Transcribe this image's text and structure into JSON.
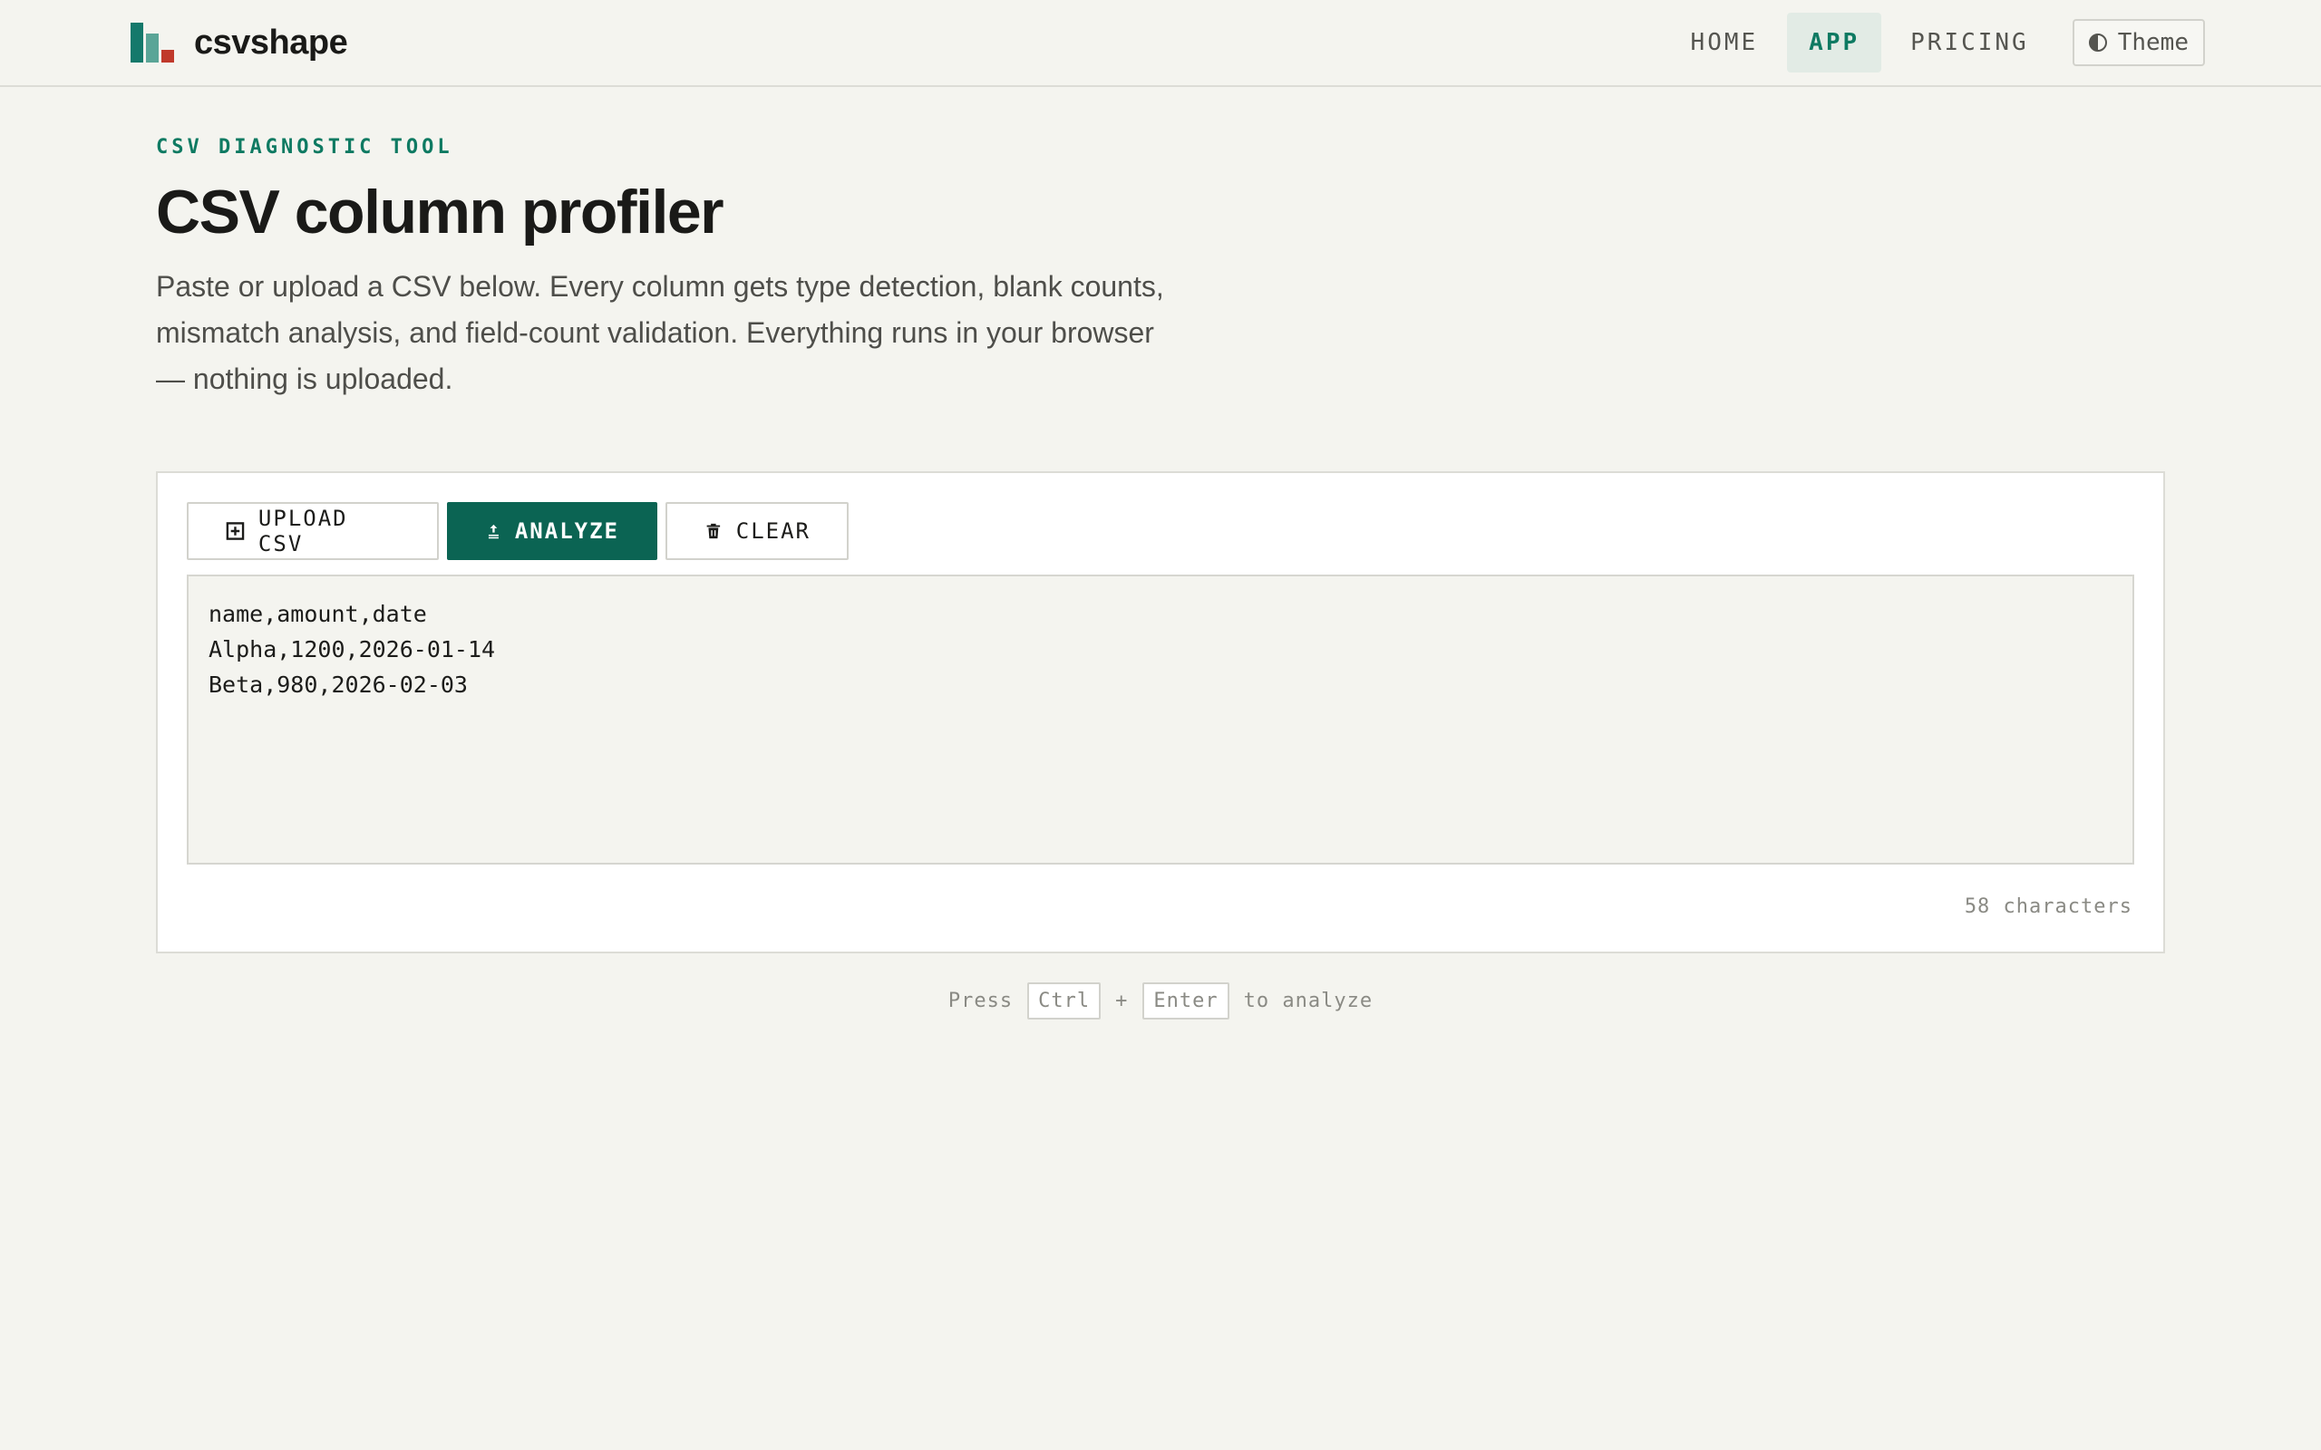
{
  "header": {
    "brand": "csvshape",
    "nav": [
      {
        "label": "HOME",
        "active": false
      },
      {
        "label": "APP",
        "active": true
      },
      {
        "label": "PRICING",
        "active": false
      }
    ],
    "theme_label": "Theme"
  },
  "hero": {
    "eyebrow": "CSV DIAGNOSTIC TOOL",
    "title": "CSV column profiler",
    "description": "Paste or upload a CSV below. Every column gets type detection, blank counts, mismatch analysis, and field-count validation. Everything runs in your browser — nothing is uploaded."
  },
  "toolbar": {
    "upload_label": "UPLOAD CSV",
    "analyze_label": "ANALYZE",
    "clear_label": "CLEAR"
  },
  "editor": {
    "value": "name,amount,date\nAlpha,1200,2026-01-14\nBeta,980,2026-02-03",
    "char_count": "58 characters"
  },
  "hint": {
    "prefix": "Press",
    "key1": "Ctrl",
    "plus": "+",
    "key2": "Enter",
    "suffix": "to analyze"
  },
  "colors": {
    "accent": "#0b6453",
    "accent_text": "#0e7a62",
    "background": "#f4f4ef"
  },
  "icons": [
    "logo-bars-icon",
    "theme-contrast-icon",
    "upload-plus-icon",
    "analyze-upload-icon",
    "trash-icon"
  ]
}
